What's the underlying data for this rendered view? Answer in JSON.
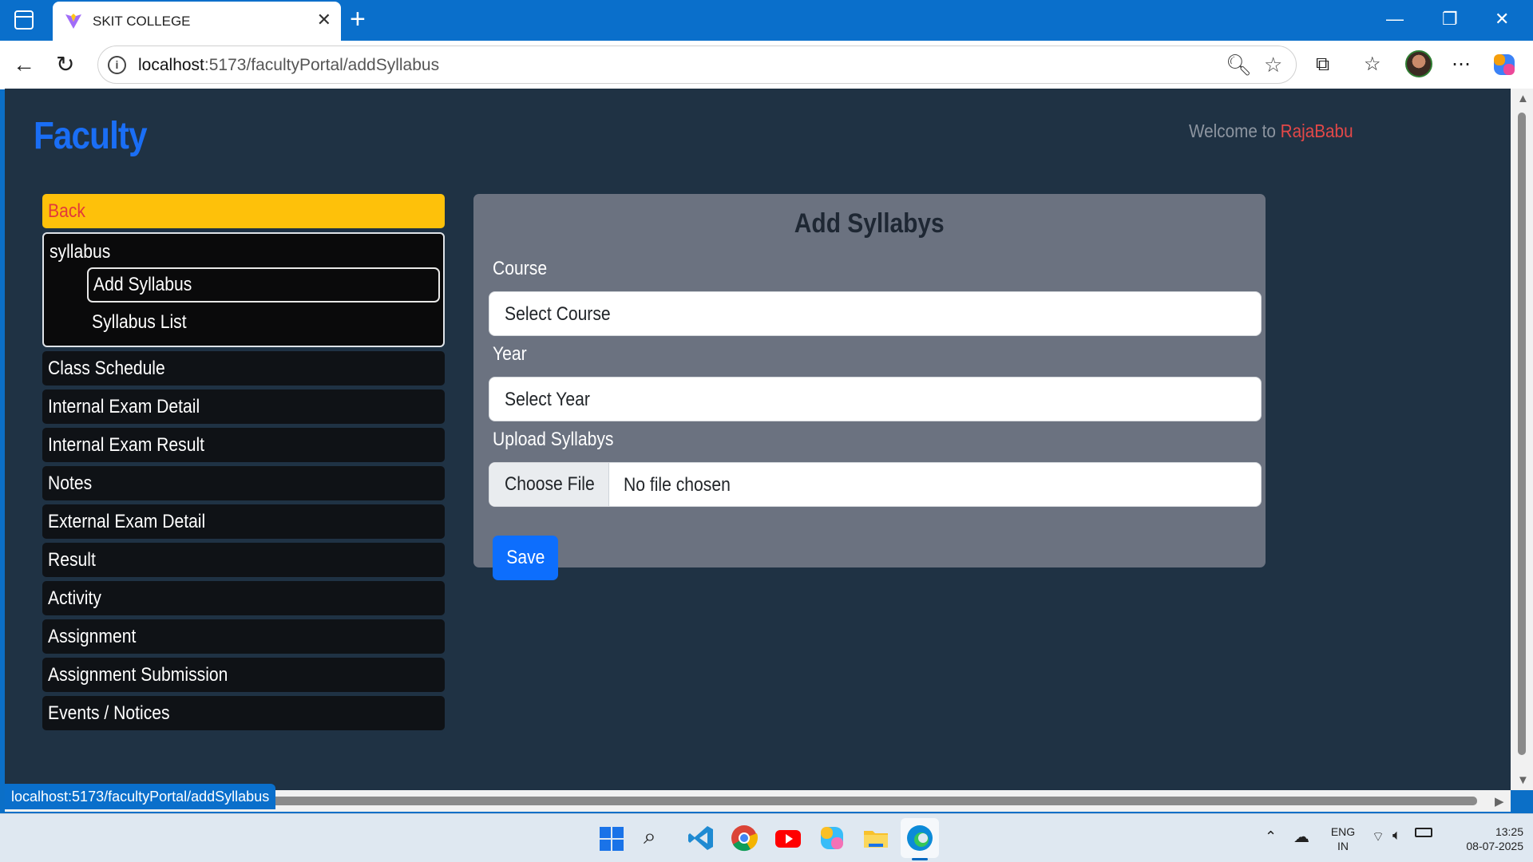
{
  "browser": {
    "tab_title": "SKIT COLLEGE",
    "tab_close": "✕",
    "new_tab": "+",
    "url_host": "localhost",
    "url_path": ":5173/facultyPortal/addSyllabus",
    "status_url": "localhost:5173/facultyPortal/addSyllabus"
  },
  "page": {
    "brand": "Faculty",
    "welcome_prefix": "Welcome to ",
    "welcome_user": "RajaBabu"
  },
  "sidebar": {
    "back_label": "Back",
    "group_title": "syllabus",
    "sub_items": [
      "Add Syllabus",
      "Syllabus List"
    ],
    "items": [
      "Class Schedule",
      "Internal Exam Detail",
      "Internal Exam Result",
      "Notes",
      "External Exam Detail",
      "Result",
      "Activity",
      "Assignment",
      "Assignment Submission",
      "Events / Notices"
    ]
  },
  "form": {
    "title": "Add Syllabys",
    "course_label": "Course",
    "course_value": "Select Course",
    "year_label": "Year",
    "year_value": "Select Year",
    "upload_label": "Upload Syllabys",
    "file_button": "Choose File",
    "file_status": "No file chosen",
    "save_label": "Save"
  },
  "taskbar": {
    "lang_top": "ENG",
    "lang_bottom": "IN",
    "time": "13:25",
    "date": "08-07-2025"
  },
  "colors": {
    "brand": "#1a6ef5",
    "back_button": "#fec10a",
    "save_button": "#0d6efd",
    "page_background": "#1f3244",
    "card_background": "#6b7280"
  }
}
